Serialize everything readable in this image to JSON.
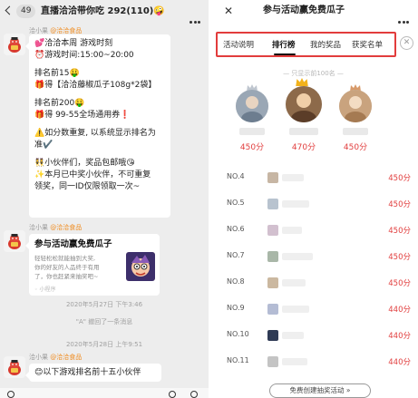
{
  "chat": {
    "back_badge": "49",
    "title": "直播洽洽带你吃 292(110)",
    "title_emoji": "🤪",
    "messages": [
      {
        "sender": "洽小果",
        "sender_tag": "@洽洽食品",
        "lines": [
          "💕洽洽本周 游戏时刻",
          "⏰游戏时间:15:00~20:00",
          "排名前15🤑",
          "🎁得【洽洽藤椒瓜子108g*2袋】",
          "排名前200🤑",
          "🎁得 99-55全场通用券❗",
          "⚠️如分数重复, 以系统显示排名为",
          "准✔️",
          "👯小伙伴们，奖品包邮哦😘",
          "✨本月已中奖小伙伴，不可重复",
          "领奖，同一ID仅限领取一次~"
        ]
      }
    ],
    "card": {
      "sender": "洽小果",
      "sender_tag": "@洽洽食品",
      "title": "参与活动赢免费瓜子",
      "desc_lines": [
        "轻轻松松就能抽到大奖,",
        "你的好友的人品终于有用",
        "了，你也赶紧来抽奖吧~"
      ],
      "source": "◦ 小程序"
    },
    "sys_time_1": "2020年5月27日 下午3:46",
    "sys_recall": "\"A\" 撤回了一条消息",
    "sys_time_2": "2020年5月28日 上午9:51",
    "last_message": {
      "sender": "洽小果",
      "sender_tag": "@洽洽食品",
      "text": "😊以下游戏排名前十五小伙伴"
    }
  },
  "activity": {
    "close_glyph": "✕",
    "title": "参与活动赢免费瓜子",
    "tabs": [
      "活动说明",
      "排行榜",
      "我的奖品",
      "获奖名单"
    ],
    "active_tab": "排行榜",
    "tabs_close_glyph": "✕",
    "only_show": "— 只显示前100名 —",
    "podium": [
      {
        "rank": 2,
        "score": "450分"
      },
      {
        "rank": 1,
        "score": "470分"
      },
      {
        "rank": 3,
        "score": "450分"
      }
    ],
    "ranking": [
      {
        "no": "NO.4",
        "score": "450分"
      },
      {
        "no": "NO.5",
        "score": "450分"
      },
      {
        "no": "NO.6",
        "score": "450分"
      },
      {
        "no": "NO.7",
        "score": "450分"
      },
      {
        "no": "NO.8",
        "score": "450分"
      },
      {
        "no": "NO.9",
        "score": "440分"
      },
      {
        "no": "NO.10",
        "score": "440分"
      },
      {
        "no": "NO.11",
        "score": "440分"
      }
    ],
    "create_button": "免费创建抽奖活动 »"
  },
  "colors": {
    "accent_red": "#e23c3c",
    "score_red": "#e13d3d",
    "chat_bg": "#ededed"
  }
}
